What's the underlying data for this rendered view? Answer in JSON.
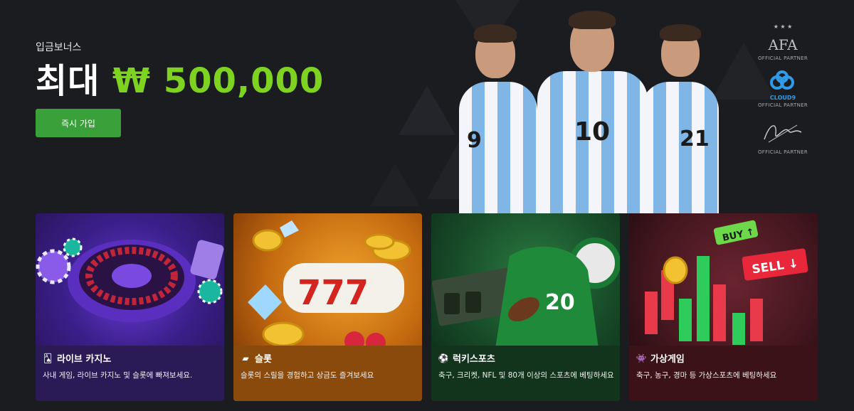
{
  "hero": {
    "subtitle": "입금보너스",
    "headline_prefix": "최대",
    "headline_amount": "₩ 500,000",
    "cta_label": "즉시 가입",
    "player_numbers": [
      "9",
      "10",
      "21"
    ]
  },
  "partners": [
    {
      "icon": "afa-logo-icon",
      "label": "OFFICIAL PARTNER",
      "logo_text": "AFA"
    },
    {
      "icon": "cloud9-logo-icon",
      "label": "OFFICIAL PARTNER",
      "logo_text": "CLOUD9"
    },
    {
      "icon": "signature-logo-icon",
      "label": "OFFICIAL PARTNER"
    }
  ],
  "cards": [
    {
      "title": "라이브 카지노",
      "description": "사내 게임, 라이브 카지노 및 슬롯에 빠져보세요.",
      "icon": "cards-icon",
      "color": "#3a2478"
    },
    {
      "title": "슬롯",
      "description": "슬롯의 스릴을 경험하고 상금도 즐겨보세요",
      "icon": "slot-icon",
      "color": "#b8620e"
    },
    {
      "title": "럭키스포츠",
      "description": "축구, 크리켓, NFL 및 80개 이상의 스포츠에 베팅하세요",
      "icon": "soccer-ball-icon",
      "color": "#184d2a"
    },
    {
      "title": "가상게임",
      "description": "축구, 농구, 경마 등 가상스포츠에 베팅하세요",
      "icon": "virtual-game-icon",
      "color": "#4a1a22"
    }
  ],
  "colors": {
    "accent": "#7ed321",
    "cta": "#3aa13a",
    "background": "#1b1c20"
  }
}
